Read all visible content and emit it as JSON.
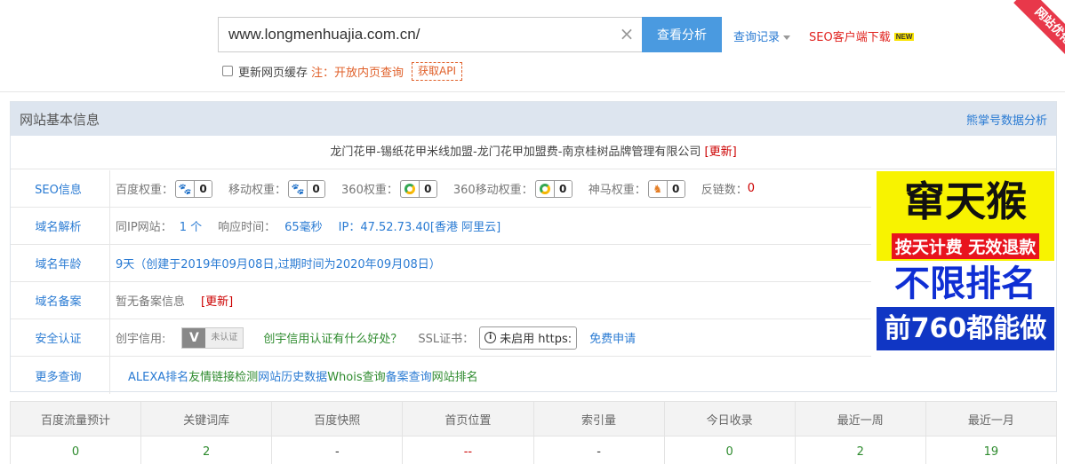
{
  "search": {
    "value": "www.longmenhuajia.com.cn/",
    "button": "查看分析",
    "history": "查询记录",
    "client_link": "SEO客户端下载",
    "new_badge": "NEW"
  },
  "options": {
    "refresh_cache_label": "更新网页缓存",
    "note": "注：开放内页查询",
    "api_link": "获取API"
  },
  "corner_ribbon": "网站优化",
  "panel": {
    "title": "网站基本信息",
    "right_link": "熊掌号数据分析",
    "site_title": "龙门花甲-锡纸花甲米线加盟-龙门花甲加盟费-南京桂树品牌管理有限公司",
    "site_title_update": "[更新]"
  },
  "seo": {
    "label": "SEO信息",
    "baidu_label": "百度权重：",
    "baidu_value": "0",
    "mobile_label": "移动权重：",
    "mobile_value": "0",
    "s360_label": "360权重：",
    "s360_value": "0",
    "s360m_label": "360移动权重：",
    "s360m_value": "0",
    "shenma_label": "神马权重：",
    "shenma_value": "0",
    "backlinks_label": "反链数：",
    "backlinks_value": "0"
  },
  "dns": {
    "label": "域名解析",
    "same_ip_label": "同IP网站：",
    "same_ip_value": "1 个",
    "resp_label": "响应时间：",
    "resp_value": "65毫秒",
    "ip_text": "IP：47.52.73.40[香港 阿里云]"
  },
  "age": {
    "label": "域名年龄",
    "value": "9天（创建于2019年09月08日,过期时间为2020年09月08日）"
  },
  "icp": {
    "label": "域名备案",
    "value": "暂无备案信息",
    "update": "[更新]"
  },
  "security": {
    "label": "安全认证",
    "cred_label": "创宇信用:",
    "cred_badge_v": "V",
    "cred_badge_text": "未认证",
    "cred_question": "创宇信用认证有什么好处？",
    "ssl_label": "SSL证书：",
    "ssl_status": "未启用 https:",
    "ssl_apply": "免费申请"
  },
  "more": {
    "label": "更多查询",
    "links": [
      "ALEXA排名",
      "友情链接检测",
      "网站历史数据",
      "Whois查询",
      "备案查询",
      "网站排名"
    ]
  },
  "ad": {
    "line1": "窜天猴",
    "line2": "按天计费 无效退款",
    "line3": "不限排名",
    "line4": "前760都能做"
  },
  "stats": {
    "headers": [
      "百度流量预计",
      "关键词库",
      "百度快照",
      "首页位置",
      "索引量",
      "今日收录",
      "最近一周",
      "最近一月"
    ],
    "values": [
      "0",
      "2",
      "-",
      "--",
      "-",
      "0",
      "2",
      "19"
    ]
  },
  "colors": {
    "accent": "#4a9ae0",
    "link": "#2a7bd3",
    "warn": "#e0602a",
    "red": "#c00000",
    "green": "#2e8b2e"
  }
}
